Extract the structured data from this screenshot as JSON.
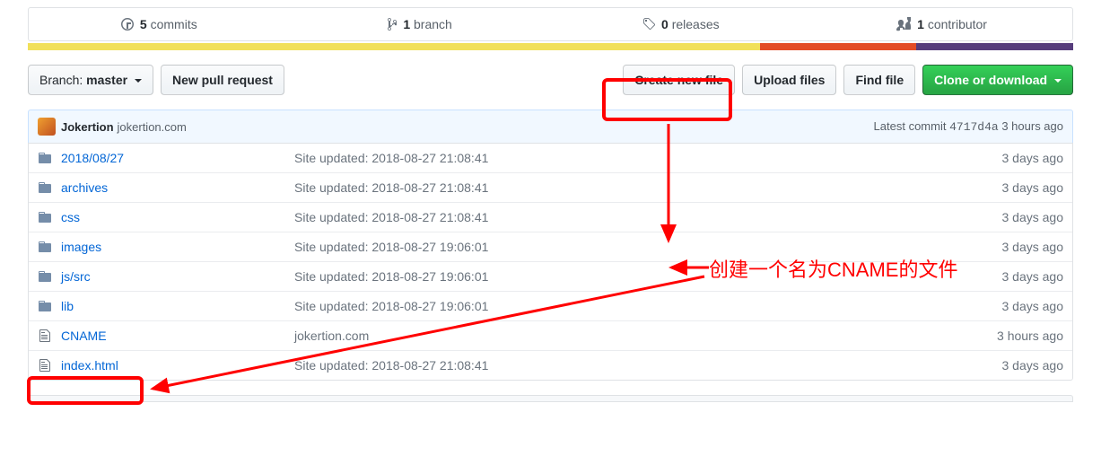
{
  "stats": {
    "commits": {
      "count": "5",
      "label": "commits"
    },
    "branches": {
      "count": "1",
      "label": "branch"
    },
    "releases": {
      "count": "0",
      "label": "releases"
    },
    "contributors": {
      "count": "1",
      "label": "contributor"
    }
  },
  "lang_colors": [
    "#f1e05a",
    "#e34c26",
    "#563d7c"
  ],
  "lang_widths": [
    "70%",
    "15%",
    "15%"
  ],
  "branch": {
    "prefix": "Branch: ",
    "name": "master"
  },
  "buttons": {
    "new_pr": "New pull request",
    "create": "Create new file",
    "upload": "Upload files",
    "find": "Find file",
    "clone": "Clone or download"
  },
  "commit_header": {
    "author": "Jokertion",
    "message": "jokertion.com",
    "latest_label": "Latest commit",
    "sha": "4717d4a",
    "when": "3 hours ago"
  },
  "files": [
    {
      "type": "dir",
      "name": "2018/08/27",
      "msg": "Site updated: 2018-08-27 21:08:41",
      "age": "3 days ago"
    },
    {
      "type": "dir",
      "name": "archives",
      "msg": "Site updated: 2018-08-27 21:08:41",
      "age": "3 days ago"
    },
    {
      "type": "dir",
      "name": "css",
      "msg": "Site updated: 2018-08-27 21:08:41",
      "age": "3 days ago"
    },
    {
      "type": "dir",
      "name": "images",
      "msg": "Site updated: 2018-08-27 19:06:01",
      "age": "3 days ago"
    },
    {
      "type": "dir",
      "name": "js/src",
      "msg": "Site updated: 2018-08-27 19:06:01",
      "age": "3 days ago"
    },
    {
      "type": "dir",
      "name": "lib",
      "msg": "Site updated: 2018-08-27 19:06:01",
      "age": "3 days ago"
    },
    {
      "type": "file",
      "name": "CNAME",
      "msg": "jokertion.com",
      "age": "3 hours ago"
    },
    {
      "type": "file",
      "name": "index.html",
      "msg": "Site updated: 2018-08-27 21:08:41",
      "age": "3 days ago"
    }
  ],
  "annotation": {
    "text": "创建一个名为CNAME的文件"
  }
}
